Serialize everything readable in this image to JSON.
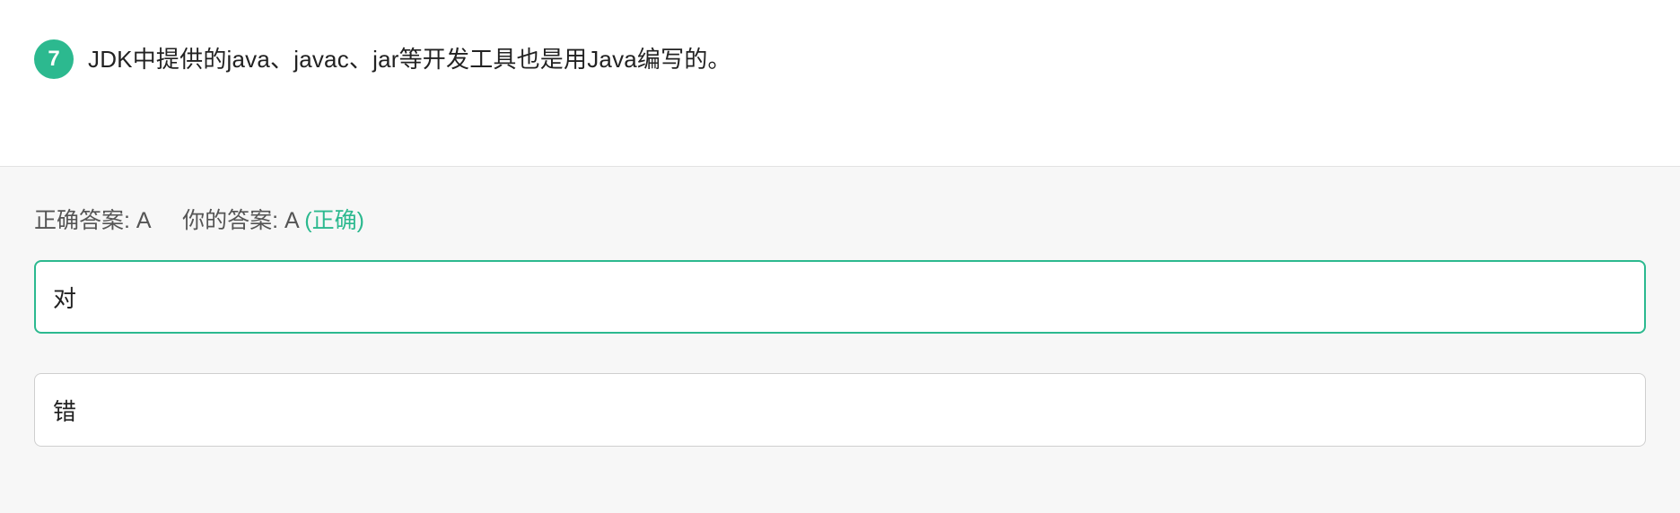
{
  "question": {
    "number": "7",
    "text": "JDK中提供的java、javac、jar等开发工具也是用Java编写的。"
  },
  "result": {
    "correct_label": "正确答案:",
    "correct_value": "A",
    "yours_label": "你的答案:",
    "yours_value": "A",
    "status": "(正确)"
  },
  "options": [
    {
      "label": "对",
      "selected": true
    },
    {
      "label": "错",
      "selected": false
    }
  ],
  "colors": {
    "accent": "#2cb98f",
    "panel_bg": "#f7f7f7"
  }
}
